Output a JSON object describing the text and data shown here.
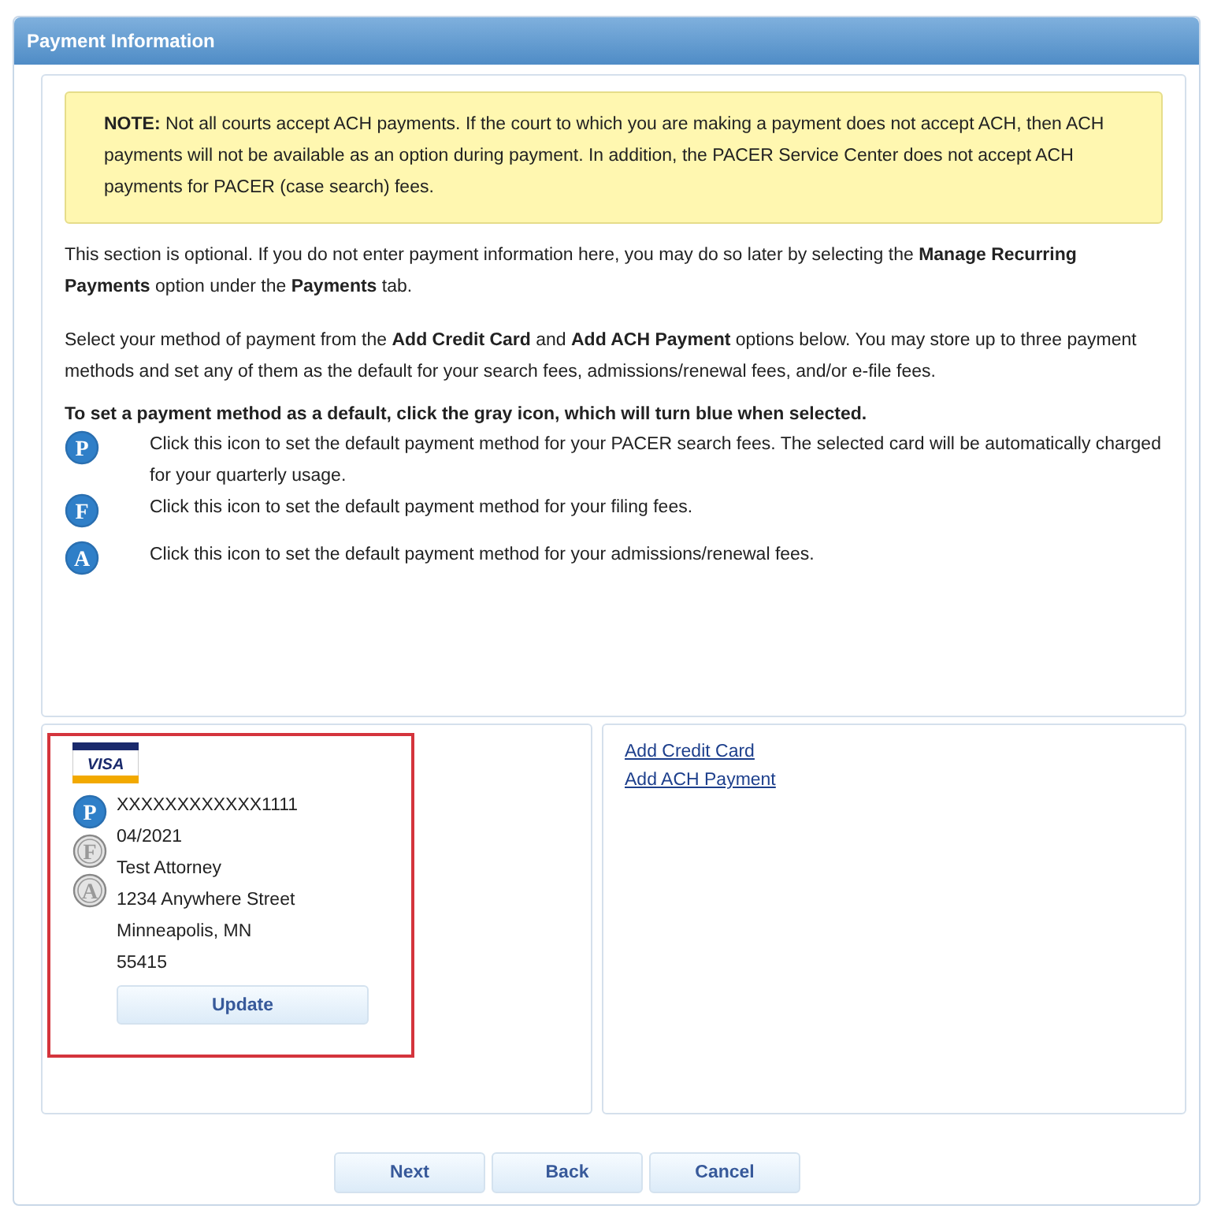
{
  "header": {
    "title": "Payment Information"
  },
  "note": "**NOTE:** Not all courts accept ACH payments. If the court to which you are making a payment does not accept ACH, then ACH payments will not be available as an option during payment. In addition, the PACER Service Center does not accept ACH payments for PACER (case search) fees.",
  "paragraphs": [
    "This section is optional. If you do not enter payment information here, you may do so later by selecting the **Manage Recurring Payments** option under the **Payments** tab.",
    "Select your method of payment from the **Add Credit Card** and **Add ACH Payment** options below. You may store up to three payment methods and set any of them as the default for your search fees, admissions/renewal fees, and/or e-file fees."
  ],
  "legend": {
    "heading": "To set a payment method as a default, click the gray icon, which will turn blue when selected.",
    "items": [
      {
        "letter": "P",
        "text": "Click this icon to set the default payment method for your PACER search fees. The selected card will be automatically charged for your quarterly usage."
      },
      {
        "letter": "F",
        "text": "Click this icon to set the default payment method for your filing fees."
      },
      {
        "letter": "A",
        "text": "Click this icon to set the default payment method for your admissions/renewal fees."
      }
    ]
  },
  "card": {
    "brand": "VISA",
    "selected": true,
    "defaults": [
      {
        "letter": "P",
        "selected": true
      },
      {
        "letter": "F",
        "selected": false
      },
      {
        "letter": "A",
        "selected": false
      }
    ],
    "lines": [
      "XXXXXXXXXXXX1111",
      "04/2021",
      "Test Attorney",
      "1234 Anywhere Street",
      "Minneapolis, MN",
      "55415"
    ],
    "button": "Update"
  },
  "links": [
    "Add Credit Card",
    "Add ACH Payment"
  ],
  "buttons": [
    "Next",
    "Back",
    "Cancel"
  ]
}
